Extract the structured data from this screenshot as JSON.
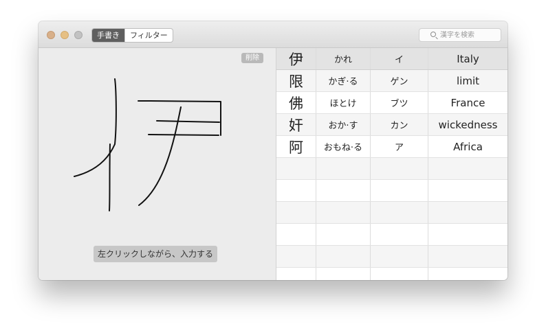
{
  "toolbar": {
    "tabs": [
      {
        "label": "手書き",
        "active": true
      },
      {
        "label": "フィルター",
        "active": false
      }
    ],
    "search_placeholder": "漢字を検索"
  },
  "canvas": {
    "delete_label": "削除",
    "hint_label": "左クリックしながら、入力する"
  },
  "table": {
    "rows": [
      {
        "kanji": "伊",
        "kun": "かれ",
        "on": "イ",
        "meaning": "Italy"
      },
      {
        "kanji": "限",
        "kun": "かぎ·る",
        "on": "ゲン",
        "meaning": "limit"
      },
      {
        "kanji": "佛",
        "kun": "ほとけ",
        "on": "ブツ",
        "meaning": "France"
      },
      {
        "kanji": "奸",
        "kun": "おか·す",
        "on": "カン",
        "meaning": "wickedness"
      },
      {
        "kanji": "阿",
        "kun": "おもね·る",
        "on": "ア",
        "meaning": "Africa"
      }
    ],
    "empty_rows": 6
  },
  "colors": {
    "selected_tab": "#5f5f5f",
    "header_row": "#e3e3e3",
    "stroke": "#111111"
  }
}
